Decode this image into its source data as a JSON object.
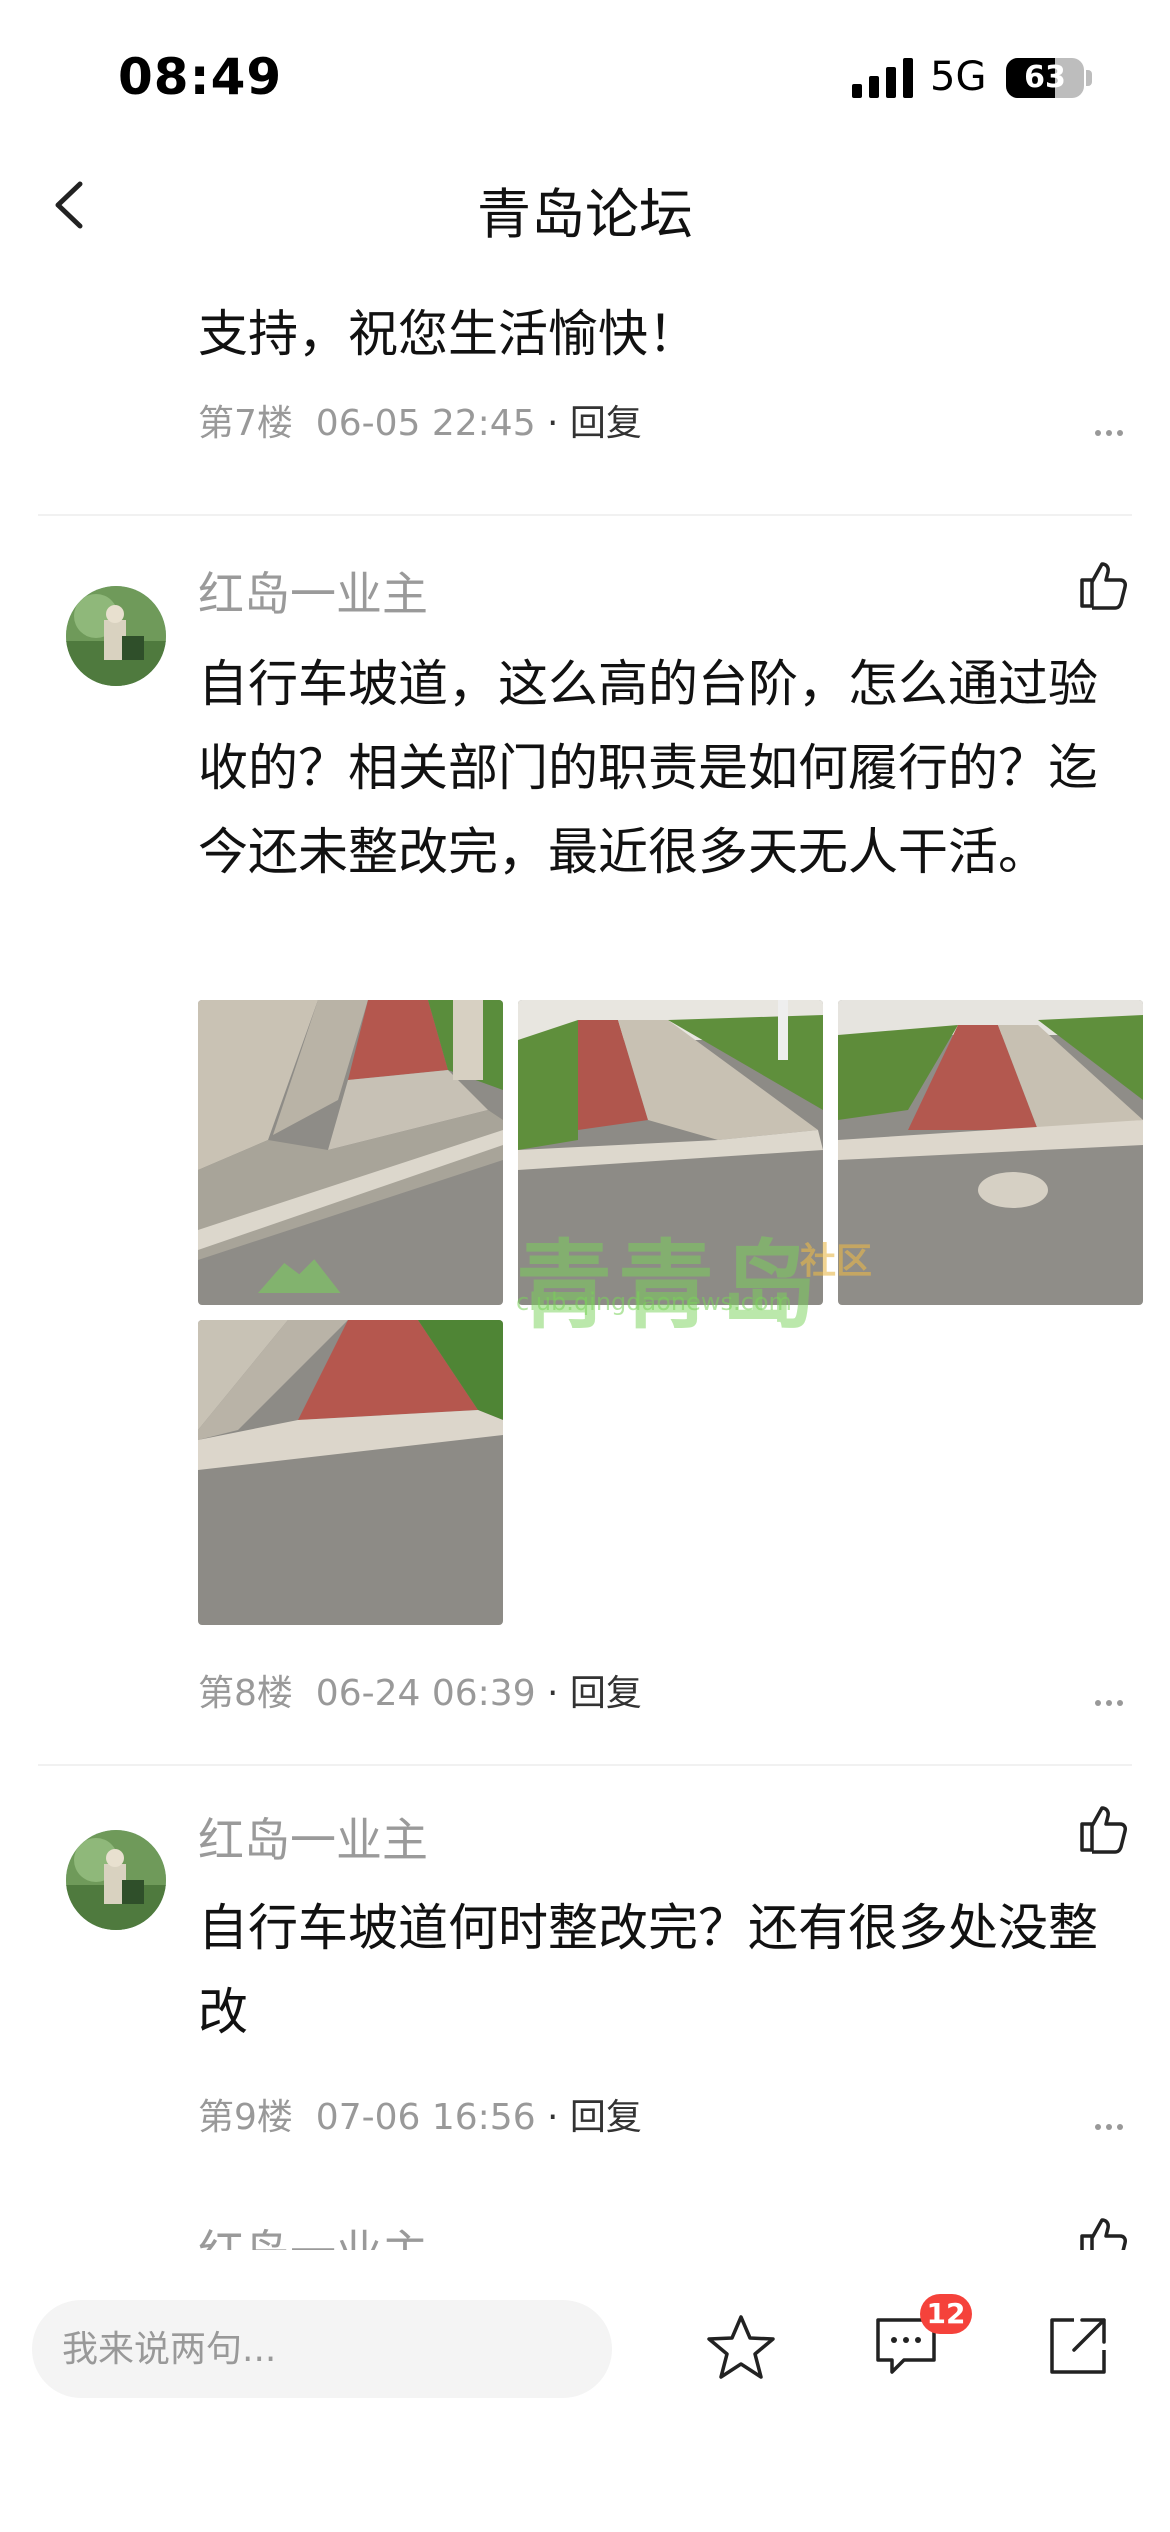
{
  "status_bar": {
    "time": "08:49",
    "network": "5G",
    "battery": "63",
    "battery_level": 0.63
  },
  "nav": {
    "title": "青岛论坛"
  },
  "posts": [
    {
      "text_partial": "...",
      "text": "支持，祝您生活愉快！",
      "floor": "第7楼",
      "timestamp": "06-05 22:45",
      "reply_label": "· 回复"
    },
    {
      "username": "红岛一业主",
      "text": "自行车坡道，这么高的台阶，怎么通过验收的？相关部门的职责是如何履行的？迄今还未整改完，最近很多天无人干活。",
      "image_count": 4,
      "floor": "第8楼",
      "timestamp": "06-24 06:39",
      "reply_label": "· 回复"
    },
    {
      "username": "红岛一业主",
      "text": "自行车坡道何时整改完？还有很多处没整改",
      "floor": "第9楼",
      "timestamp": "07-06 16:56",
      "reply_label": "· 回复"
    },
    {
      "username": "红岛一业主"
    }
  ],
  "watermark": {
    "text": "青青岛",
    "sub": "社区",
    "url": "club.qingdaonews.com"
  },
  "bottom_bar": {
    "input_placeholder": "我来说两句...",
    "comment_count": "12"
  },
  "icons": [
    "back-arrow-icon",
    "signal-icon",
    "battery-icon",
    "more-dots-icon",
    "thumbs-up-icon",
    "star-icon",
    "comment-icon",
    "share-icon"
  ],
  "colors": {
    "badge": "#f5423b",
    "muted_text": "#9a9a9a",
    "divider": "#f1f1f1"
  }
}
